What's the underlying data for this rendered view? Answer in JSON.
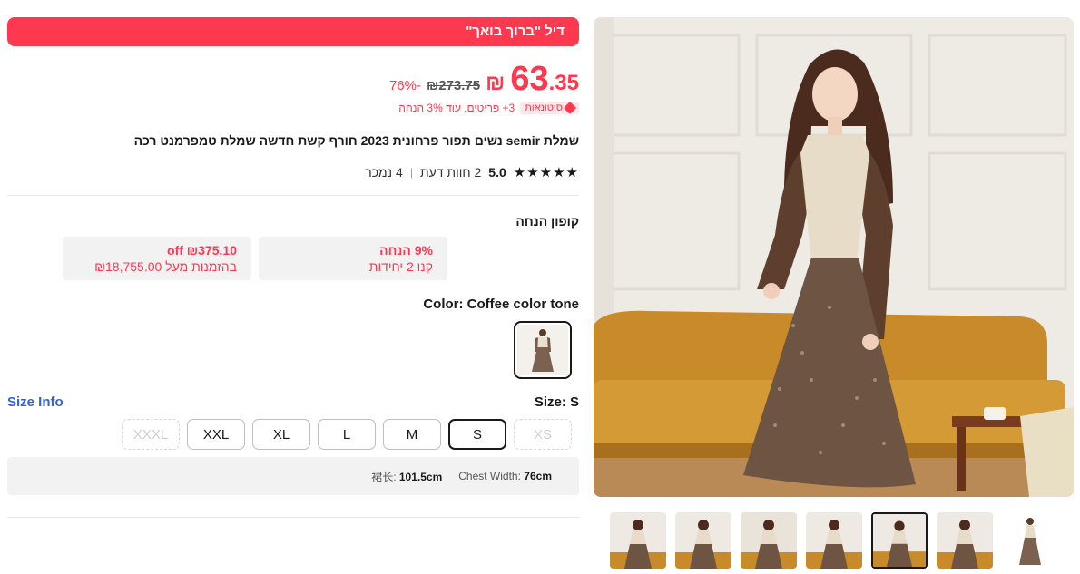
{
  "deal": {
    "banner": "דיל \"ברוך בואך\""
  },
  "price": {
    "currency": "₪",
    "integer": "63",
    "decimal": ".35",
    "original": "₪273.75",
    "discount": "76%-"
  },
  "bulk": {
    "badge": "סיטונאות",
    "text": "3+ פריטים, עוד 3% הנחה"
  },
  "product": {
    "title": "שמלת semir נשים תפור פרחונית 2023 חורף קשת חדשה שמלת טמפרמנט רכה"
  },
  "rating": {
    "stars": "★★★★★",
    "score": "5.0",
    "reviews": "2 חוות דעת",
    "separator": "|",
    "sold": "4 נמכר"
  },
  "coupons": {
    "title": "קופון הנחה",
    "items": [
      {
        "top": "9% הנחה",
        "bottom": "קנו 2 יחידות"
      },
      {
        "top": "off ₪375.10",
        "bottom": "בהזמנות מעל ₪18,755.00"
      }
    ]
  },
  "color": {
    "label": "Color: Coffee color tone"
  },
  "size": {
    "label": "Size: S",
    "info_link": "Size Info",
    "options": [
      {
        "label": "XXXL",
        "state": "disabled"
      },
      {
        "label": "XXL",
        "state": "available"
      },
      {
        "label": "XL",
        "state": "available"
      },
      {
        "label": "L",
        "state": "available"
      },
      {
        "label": "M",
        "state": "available"
      },
      {
        "label": "S",
        "state": "selected"
      },
      {
        "label": "XS",
        "state": "disabled"
      }
    ]
  },
  "measurements": {
    "chest_label": "Chest Width:",
    "chest_value": "76cm",
    "length_label": "裙长:",
    "length_value": "101.5cm"
  },
  "gallery": {
    "thumb_count": 7,
    "selected_index": 4
  },
  "colors": {
    "accent": "#fd384f",
    "link": "#2e64d4"
  }
}
